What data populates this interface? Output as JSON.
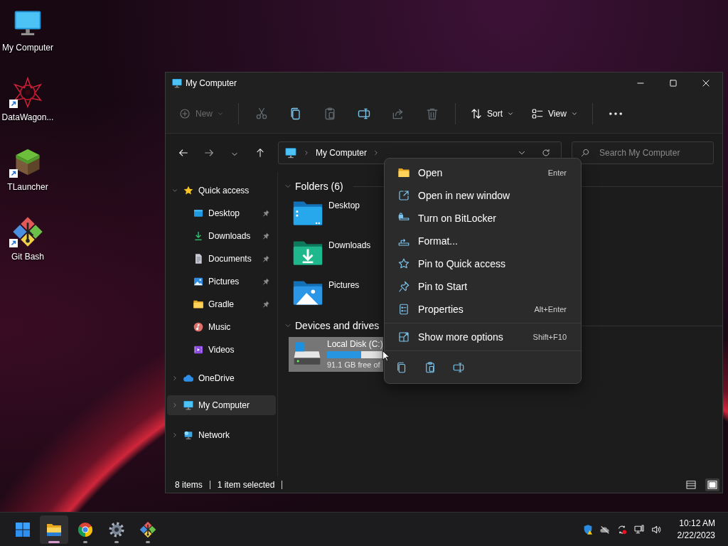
{
  "desktop_icons": [
    {
      "label": "My Computer",
      "kind": "monitor",
      "shortcut": false
    },
    {
      "label": "DataWagon...",
      "kind": "datawagon",
      "shortcut": true
    },
    {
      "label": "TLauncher",
      "kind": "grass",
      "shortcut": true
    },
    {
      "label": "Git Bash",
      "kind": "git",
      "shortcut": true
    }
  ],
  "window": {
    "title": "My Computer",
    "toolbar": {
      "new": {
        "label": "New",
        "disabled": true
      },
      "actions": [
        {
          "kind": "cut",
          "disabled": true
        },
        {
          "kind": "copy",
          "disabled": false
        },
        {
          "kind": "paste",
          "disabled": true
        },
        {
          "kind": "rename",
          "disabled": false
        },
        {
          "kind": "share",
          "disabled": true
        },
        {
          "kind": "delete",
          "disabled": true
        }
      ],
      "sort": {
        "label": "Sort"
      },
      "view": {
        "label": "View"
      }
    },
    "address_bar": {
      "breadcrumbs": [
        "My Computer"
      ]
    },
    "search": {
      "placeholder": "Search My Computer"
    },
    "navigation": [
      {
        "label": "Quick access",
        "kind": "star",
        "expanded": true,
        "selected": false,
        "children": [
          {
            "label": "Desktop",
            "kind": "desktop",
            "pinned": true
          },
          {
            "label": "Downloads",
            "kind": "downloads",
            "pinned": true
          },
          {
            "label": "Documents",
            "kind": "documents",
            "pinned": true
          },
          {
            "label": "Pictures",
            "kind": "pictures",
            "pinned": true
          },
          {
            "label": "Gradle",
            "kind": "folder",
            "pinned": true
          },
          {
            "label": "Music",
            "kind": "music",
            "pinned": false
          },
          {
            "label": "Videos",
            "kind": "videos",
            "pinned": false
          }
        ]
      },
      {
        "label": "OneDrive",
        "kind": "cloud",
        "expanded": false,
        "selected": false
      },
      {
        "label": "My Computer",
        "kind": "monitor",
        "expanded": false,
        "selected": true
      },
      {
        "label": "Network",
        "kind": "network",
        "expanded": false,
        "selected": false
      }
    ],
    "sections": [
      {
        "kind": "folders",
        "title": "Folders (6)",
        "expanded": true,
        "items": [
          {
            "label": "Desktop",
            "kind": "desktop"
          },
          {
            "label": "Downloads",
            "kind": "downloads"
          },
          {
            "label": "Pictures",
            "kind": "pictures"
          }
        ]
      },
      {
        "kind": "drives",
        "title": "Devices and drives",
        "expanded": true,
        "items": [
          {
            "label": "Local Disk (C:)",
            "detail": "91.1 GB free of",
            "level": 0.62,
            "selected": true
          }
        ]
      }
    ],
    "status_bar": {
      "item_count": "8 items",
      "selection": "1 item selected",
      "view_buttons": [
        {
          "kind": "details",
          "selected": false
        },
        {
          "kind": "tiles",
          "selected": true
        }
      ]
    }
  },
  "context_menu": {
    "items": [
      {
        "kind": "open",
        "label": "Open",
        "shortcut": "Enter"
      },
      {
        "kind": "open-window",
        "label": "Open in new window"
      },
      {
        "kind": "bitlocker",
        "label": "Turn on BitLocker"
      },
      {
        "kind": "format",
        "label": "Format..."
      },
      {
        "kind": "pin-quick",
        "label": "Pin to Quick access"
      },
      {
        "kind": "pin-start",
        "label": "Pin to Start"
      },
      {
        "kind": "properties",
        "label": "Properties",
        "shortcut": "Alt+Enter"
      }
    ],
    "more": {
      "label": "Show more options",
      "shortcut": "Shift+F10"
    },
    "quick_actions": [
      {
        "kind": "copy"
      },
      {
        "kind": "paste"
      },
      {
        "kind": "rename"
      }
    ]
  },
  "taskbar": {
    "apps": [
      {
        "kind": "start",
        "running": false,
        "active": false
      },
      {
        "kind": "explorer",
        "running": true,
        "active": true
      },
      {
        "kind": "chrome",
        "running": true,
        "active": false
      },
      {
        "kind": "settings",
        "running": true,
        "active": false
      },
      {
        "kind": "git",
        "running": true,
        "active": false
      }
    ],
    "tray": [
      {
        "kind": "security"
      },
      {
        "kind": "cloud-off"
      },
      {
        "kind": "sync"
      },
      {
        "kind": "network"
      },
      {
        "kind": "volume"
      }
    ],
    "time": "10:12 AM",
    "date": "2/22/2023"
  }
}
